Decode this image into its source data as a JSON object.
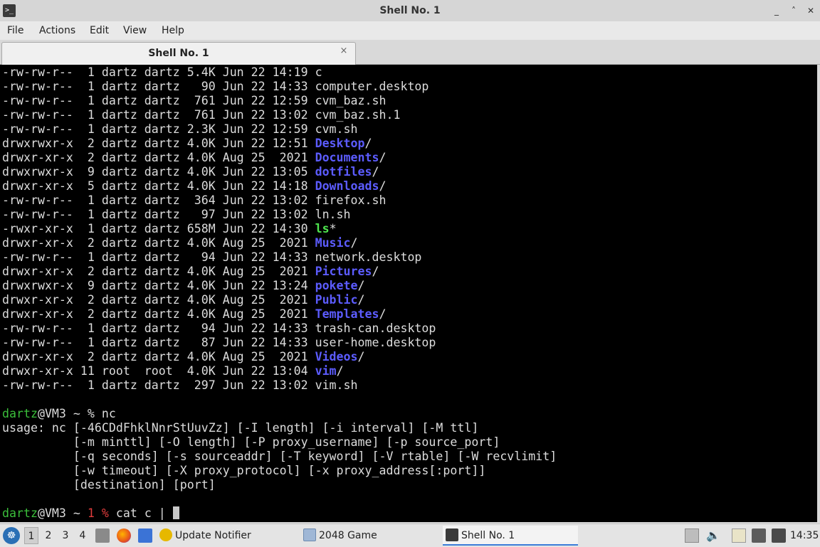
{
  "window": {
    "title": "Shell No. 1",
    "minimize": "_",
    "maximize": "˄",
    "restore": "◇",
    "close": "✕"
  },
  "menu": [
    "File",
    "Actions",
    "Edit",
    "View",
    "Help"
  ],
  "tab": {
    "label": "Shell No. 1",
    "close": "×"
  },
  "terminal": {
    "lines": [
      [
        {
          "t": "-rw-rw-r--  1 dartz dartz 5.4K Jun 22 14:19 c"
        }
      ],
      [
        {
          "t": "-rw-rw-r--  1 dartz dartz   90 Jun 22 14:33 computer.desktop"
        }
      ],
      [
        {
          "t": "-rw-rw-r--  1 dartz dartz  761 Jun 22 12:59 cvm_baz.sh"
        }
      ],
      [
        {
          "t": "-rw-rw-r--  1 dartz dartz  761 Jun 22 13:02 cvm_baz.sh.1"
        }
      ],
      [
        {
          "t": "-rw-rw-r--  1 dartz dartz 2.3K Jun 22 12:59 cvm.sh"
        }
      ],
      [
        {
          "t": "drwxrwxr-x  2 dartz dartz 4.0K Jun 22 12:51 "
        },
        {
          "t": "Desktop",
          "c": "dir"
        },
        {
          "t": "/"
        }
      ],
      [
        {
          "t": "drwxr-xr-x  2 dartz dartz 4.0K Aug 25  2021 "
        },
        {
          "t": "Documents",
          "c": "dir"
        },
        {
          "t": "/"
        }
      ],
      [
        {
          "t": "drwxrwxr-x  9 dartz dartz 4.0K Jun 22 13:05 "
        },
        {
          "t": "dotfiles",
          "c": "dir"
        },
        {
          "t": "/"
        }
      ],
      [
        {
          "t": "drwxr-xr-x  5 dartz dartz 4.0K Jun 22 14:18 "
        },
        {
          "t": "Downloads",
          "c": "dir"
        },
        {
          "t": "/"
        }
      ],
      [
        {
          "t": "-rw-rw-r--  1 dartz dartz  364 Jun 22 13:02 firefox.sh"
        }
      ],
      [
        {
          "t": "-rw-rw-r--  1 dartz dartz   97 Jun 22 13:02 ln.sh"
        }
      ],
      [
        {
          "t": "-rwxr-xr-x  1 dartz dartz 658M Jun 22 14:30 "
        },
        {
          "t": "ls",
          "c": "exe"
        },
        {
          "t": "*"
        }
      ],
      [
        {
          "t": "drwxr-xr-x  2 dartz dartz 4.0K Aug 25  2021 "
        },
        {
          "t": "Music",
          "c": "dir"
        },
        {
          "t": "/"
        }
      ],
      [
        {
          "t": "-rw-rw-r--  1 dartz dartz   94 Jun 22 14:33 network.desktop"
        }
      ],
      [
        {
          "t": "drwxr-xr-x  2 dartz dartz 4.0K Aug 25  2021 "
        },
        {
          "t": "Pictures",
          "c": "dir"
        },
        {
          "t": "/"
        }
      ],
      [
        {
          "t": "drwxrwxr-x  9 dartz dartz 4.0K Jun 22 13:24 "
        },
        {
          "t": "pokete",
          "c": "dir"
        },
        {
          "t": "/"
        }
      ],
      [
        {
          "t": "drwxr-xr-x  2 dartz dartz 4.0K Aug 25  2021 "
        },
        {
          "t": "Public",
          "c": "dir"
        },
        {
          "t": "/"
        }
      ],
      [
        {
          "t": "drwxr-xr-x  2 dartz dartz 4.0K Aug 25  2021 "
        },
        {
          "t": "Templates",
          "c": "dir"
        },
        {
          "t": "/"
        }
      ],
      [
        {
          "t": "-rw-rw-r--  1 dartz dartz   94 Jun 22 14:33 trash-can.desktop"
        }
      ],
      [
        {
          "t": "-rw-rw-r--  1 dartz dartz   87 Jun 22 14:33 user-home.desktop"
        }
      ],
      [
        {
          "t": "drwxr-xr-x  2 dartz dartz 4.0K Aug 25  2021 "
        },
        {
          "t": "Videos",
          "c": "dir"
        },
        {
          "t": "/"
        }
      ],
      [
        {
          "t": "drwxr-xr-x 11 root  root  4.0K Jun 22 13:04 "
        },
        {
          "t": "vim",
          "c": "dir"
        },
        {
          "t": "/"
        }
      ],
      [
        {
          "t": "-rw-rw-r--  1 dartz dartz  297 Jun 22 13:02 vim.sh"
        }
      ],
      [
        {
          "t": ""
        }
      ],
      [
        {
          "t": "dartz",
          "c": "green"
        },
        {
          "t": "@VM3 ~ % nc"
        }
      ],
      [
        {
          "t": "usage: nc [-46CDdFhklNnrStUuvZz] [-I length] [-i interval] [-M ttl]"
        }
      ],
      [
        {
          "t": "          [-m minttl] [-O length] [-P proxy_username] [-p source_port]"
        }
      ],
      [
        {
          "t": "          [-q seconds] [-s sourceaddr] [-T keyword] [-V rtable] [-W recvlimit]"
        }
      ],
      [
        {
          "t": "          [-w timeout] [-X proxy_protocol] [-x proxy_address[:port]]"
        }
      ],
      [
        {
          "t": "          [destination] [port]"
        }
      ],
      [
        {
          "t": ""
        }
      ],
      [
        {
          "t": "dartz",
          "c": "green"
        },
        {
          "t": "@VM3 ~ "
        },
        {
          "t": "1 %",
          "c": "red"
        },
        {
          "t": " cat c | "
        },
        {
          "t": "",
          "c": "cursor"
        }
      ]
    ]
  },
  "taskbar": {
    "menu_icon": "start-menu-icon",
    "workspaces": [
      "1",
      "2",
      "3",
      "4"
    ],
    "active_workspace": "1",
    "quicklaunch": [
      "file-manager-icon",
      "firefox-icon",
      "desktop-icon"
    ],
    "tasks": [
      {
        "label": "Update Notifier",
        "icon": "update-notifier-icon",
        "active": false
      },
      {
        "label": "2048 Game",
        "icon": "game-window-icon",
        "active": false
      },
      {
        "label": "Shell No. 1",
        "icon": "terminal-icon",
        "active": true
      }
    ],
    "tray": [
      "updates-icon",
      "volume-icon",
      "clipboard-icon",
      "network-icon",
      "keyboard-icon"
    ],
    "clock": "14:35"
  },
  "colors": {
    "dir": "#5c5cff",
    "exe": "#4ee44e",
    "prompt_user": "#3bbf3b",
    "exit_code": "#e03c3c",
    "active_task": "#3b7dd8"
  }
}
